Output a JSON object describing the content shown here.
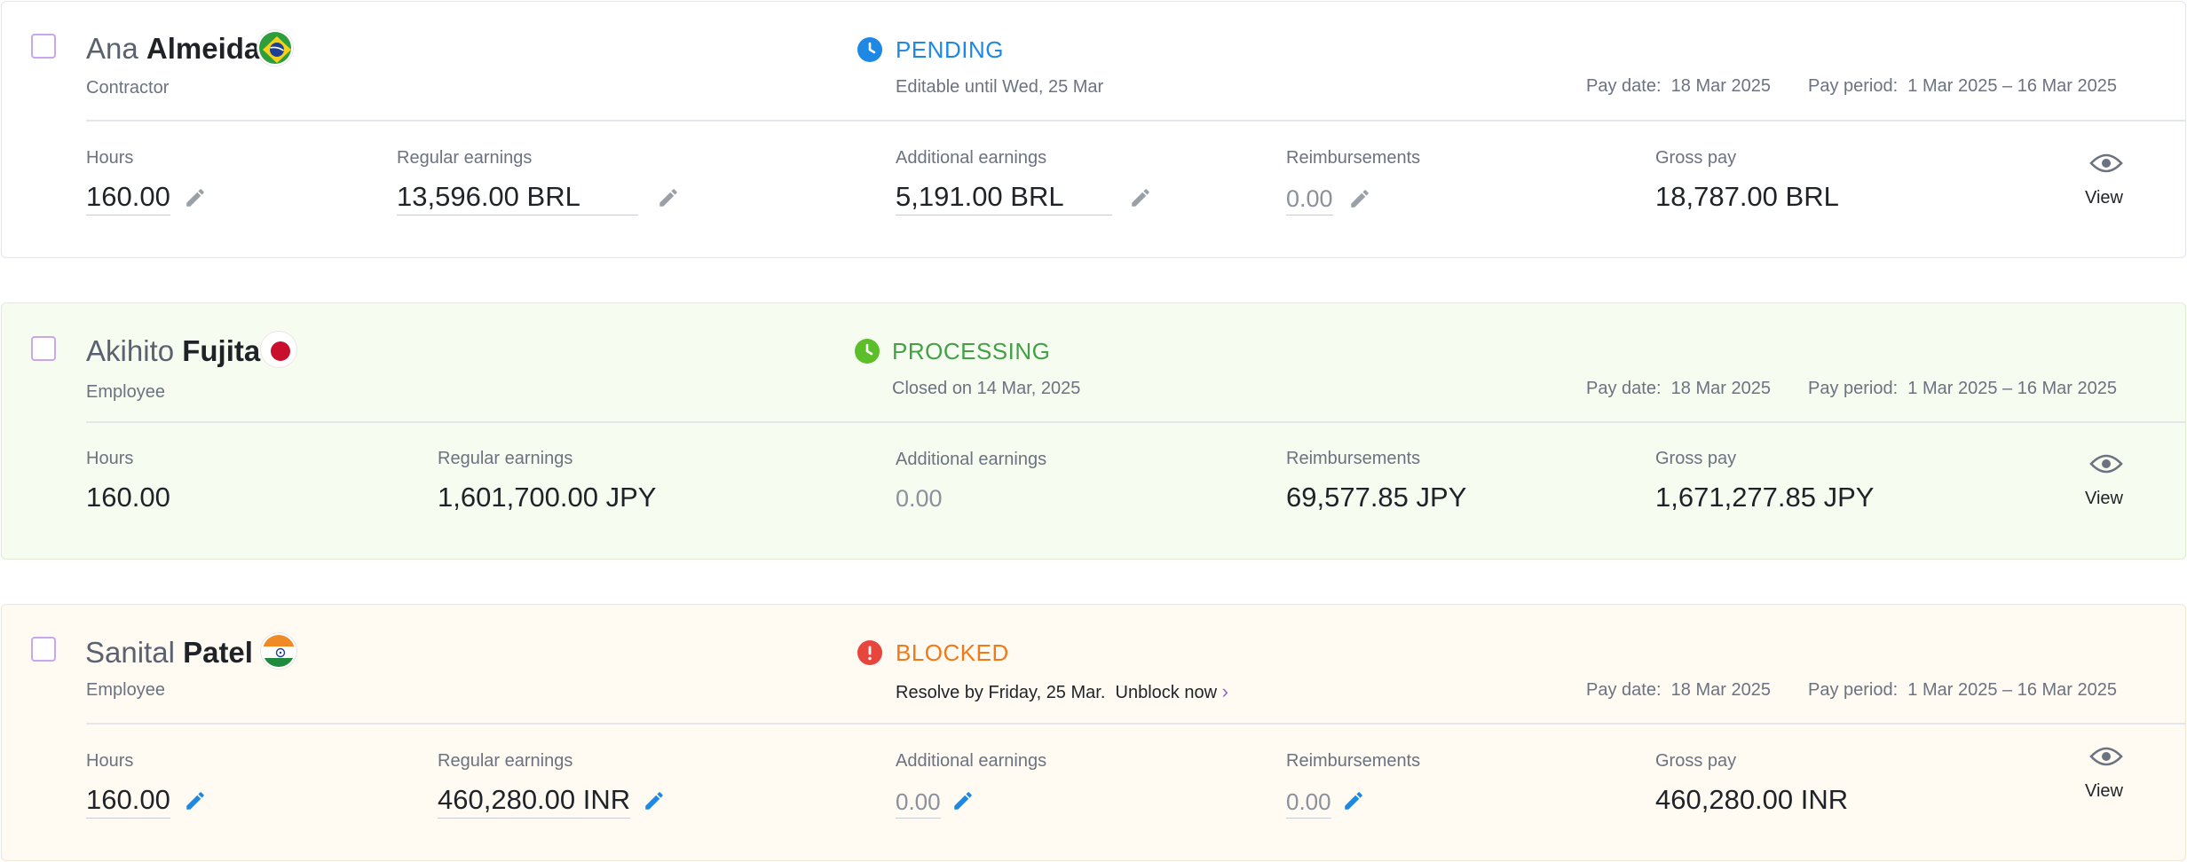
{
  "rows": [
    {
      "first_name": "Ana",
      "last_name": "Almeida",
      "flag": "brazil-flag-icon",
      "role": "Contractor",
      "status": "PENDING",
      "status_color": "#1e88e5",
      "status_detail": "Editable until Wed, 25 Mar",
      "pay_date_label": "Pay date:",
      "pay_date": "18 Mar 2025",
      "pay_period_label": "Pay period:",
      "pay_period": "1 Mar 2025 – 16 Mar 2025",
      "hours_label": "Hours",
      "hours": "160.00",
      "regular_label": "Regular earnings",
      "regular": "13,596.00 BRL",
      "additional_label": "Additional earnings",
      "additional": "5,191.00 BRL",
      "reimb_label": "Reimbursements",
      "reimb": "0.00",
      "gross_label": "Gross pay",
      "gross": "18,787.00 BRL",
      "view": "View"
    },
    {
      "first_name": "Akihito",
      "last_name": "Fujita",
      "flag": "japan-flag-icon",
      "role": "Employee",
      "status": "PROCESSING",
      "status_color": "#43a047",
      "status_detail": "Closed on 14 Mar, 2025",
      "pay_date_label": "Pay date:",
      "pay_date": "18 Mar 2025",
      "pay_period_label": "Pay period:",
      "pay_period": "1 Mar 2025 – 16 Mar 2025",
      "hours_label": "Hours",
      "hours": "160.00",
      "regular_label": "Regular earnings",
      "regular": "1,601,700.00 JPY",
      "additional_label": "Additional earnings",
      "additional": "0.00",
      "reimb_label": "Reimbursements",
      "reimb": "69,577.85 JPY",
      "gross_label": "Gross pay",
      "gross": "1,671,277.85 JPY",
      "view": "View"
    },
    {
      "first_name": "Sanital",
      "last_name": "Patel",
      "flag": "india-flag-icon",
      "role": "Employee",
      "status": "BLOCKED",
      "status_color": "#f07a1a",
      "status_detail": "Resolve by Friday, 25 Mar.",
      "status_link": "Unblock now",
      "pay_date_label": "Pay date:",
      "pay_date": "18 Mar 2025",
      "pay_period_label": "Pay period:",
      "pay_period": "1 Mar 2025 – 16 Mar 2025",
      "hours_label": "Hours",
      "hours": "160.00",
      "regular_label": "Regular earnings",
      "regular": "460,280.00 INR",
      "additional_label": "Additional earnings",
      "additional": "0.00",
      "reimb_label": "Reimbursements",
      "reimb": "0.00",
      "gross_label": "Gross pay",
      "gross": "460,280.00 INR",
      "view": "View"
    }
  ],
  "colors": {
    "pending": "#1e88e5",
    "processing": "#43a047",
    "blocked": "#f07a1a",
    "error_icon": "#e8453c",
    "edit_active": "#1e88e5",
    "edit_muted": "#9aa0a8",
    "checkbox_border": "#c9a6ee"
  }
}
